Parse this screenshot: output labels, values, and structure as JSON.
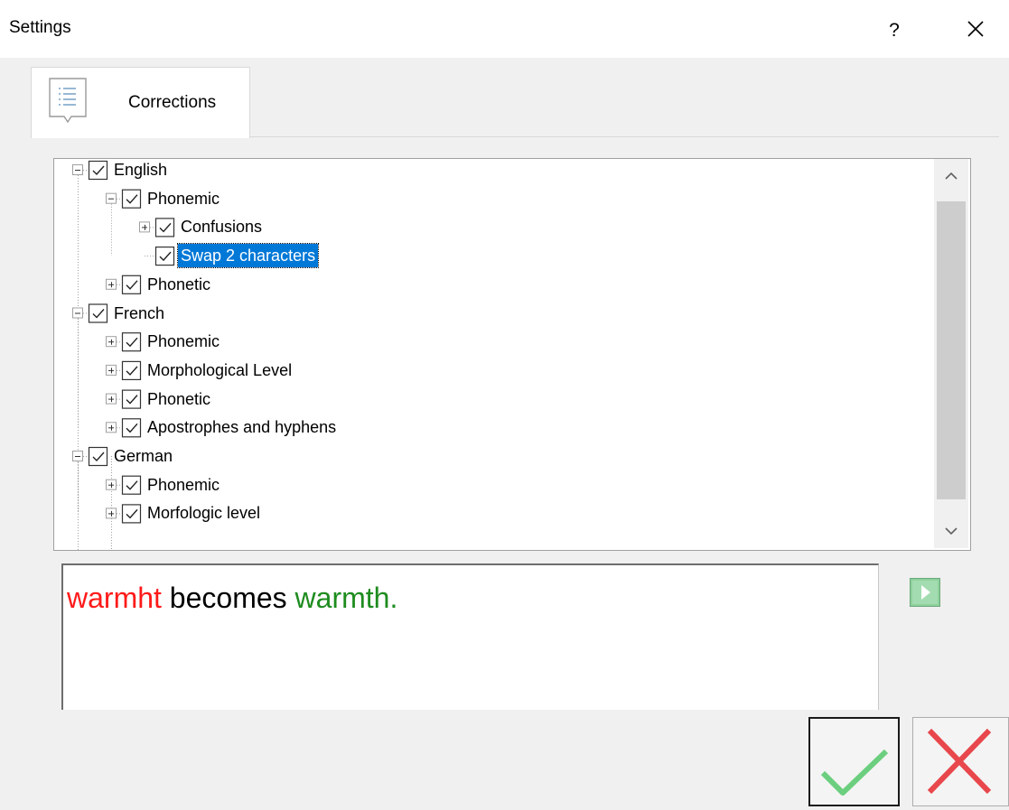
{
  "window": {
    "title": "Settings",
    "help_label": "?"
  },
  "tabs": [
    {
      "label": "Corrections",
      "icon": "list-icon"
    }
  ],
  "tree": {
    "nodes": [
      {
        "label": "English",
        "level": 0,
        "expander": "minus",
        "checked": true
      },
      {
        "label": "Phonemic",
        "level": 1,
        "expander": "minus",
        "checked": true
      },
      {
        "label": "Confusions",
        "level": 2,
        "expander": "plus",
        "checked": true
      },
      {
        "label": "Swap 2 characters",
        "level": 2,
        "expander": "none",
        "checked": true,
        "selected": true
      },
      {
        "label": "Phonetic",
        "level": 1,
        "expander": "plus",
        "checked": true
      },
      {
        "label": "French",
        "level": 0,
        "expander": "minus",
        "checked": true
      },
      {
        "label": "Phonemic",
        "level": 1,
        "expander": "plus",
        "checked": true
      },
      {
        "label": "Morphological Level",
        "level": 1,
        "expander": "plus",
        "checked": true
      },
      {
        "label": "Phonetic",
        "level": 1,
        "expander": "plus",
        "checked": true
      },
      {
        "label": "Apostrophes and hyphens",
        "level": 1,
        "expander": "plus",
        "checked": true
      },
      {
        "label": "German",
        "level": 0,
        "expander": "minus",
        "checked": true
      },
      {
        "label": "Phonemic",
        "level": 1,
        "expander": "plus",
        "checked": true
      },
      {
        "label": "Morfologic level",
        "level": 1,
        "expander": "plus",
        "checked": true
      }
    ]
  },
  "preview": {
    "wrong": "warmht",
    "middle": " becomes ",
    "right": "warmth.",
    "colors": {
      "wrong": "#ff1a1a",
      "middle": "#000000",
      "right": "#1e8c1e"
    }
  },
  "buttons": {
    "ok_color": "#6ccf7f",
    "cancel_color": "#e8474c"
  }
}
